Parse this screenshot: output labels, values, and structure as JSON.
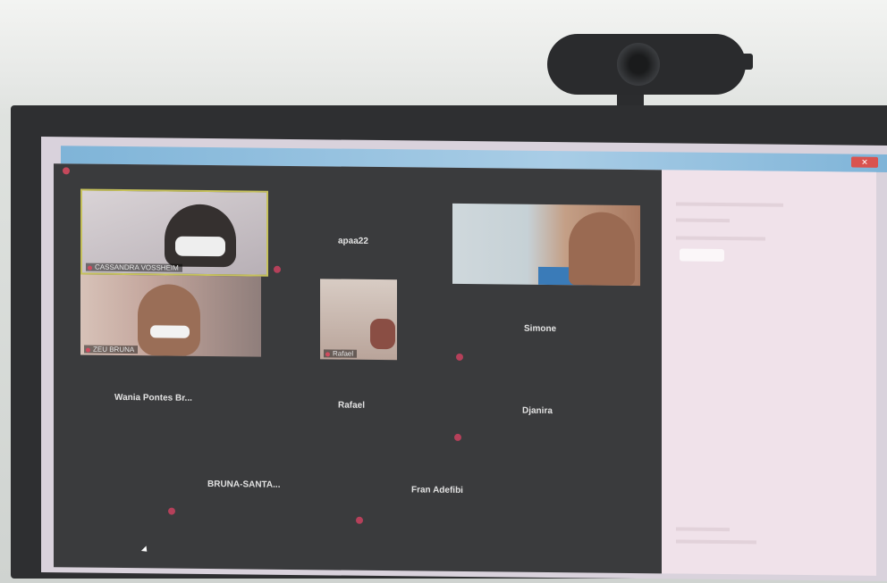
{
  "meeting": {
    "recording_label": "",
    "participants_video": [
      {
        "id": "p1",
        "name": "CASSANDRA VOSSHEIM"
      },
      {
        "id": "p2",
        "name": "ZEU BRUNA"
      },
      {
        "id": "p3",
        "name": "Rafael"
      },
      {
        "id": "p4",
        "name": ""
      }
    ],
    "participants_no_video": [
      {
        "id": "apaa22",
        "name": "apaa22"
      },
      {
        "id": "simone",
        "name": "Simone"
      },
      {
        "id": "wania",
        "name": "Wania Pontes Br..."
      },
      {
        "id": "rafael",
        "name": "Rafael"
      },
      {
        "id": "djanira",
        "name": "Djanira"
      },
      {
        "id": "bruna",
        "name": "BRUNA-SANTA..."
      },
      {
        "id": "fran",
        "name": "Fran Adefibi"
      }
    ]
  },
  "chat": {
    "title": ""
  },
  "colors": {
    "record_dot": "#c4485b",
    "active_speaker_border": "#c7c25c",
    "window_title_bar": "#a9cde6",
    "chat_bg": "#f0e2ea"
  }
}
